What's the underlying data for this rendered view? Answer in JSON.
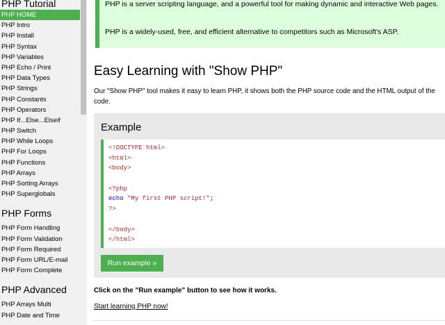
{
  "sidebar": {
    "heading_tutorial": "PHP Tutorial",
    "tutorial_items": [
      "PHP HOME",
      "PHP Intro",
      "PHP Install",
      "PHP Syntax",
      "PHP Variables",
      "PHP Echo / Print",
      "PHP Data Types",
      "PHP Strings",
      "PHP Constants",
      "PHP Operators",
      "PHP If...Else...Elseif",
      "PHP Switch",
      "PHP While Loops",
      "PHP For Loops",
      "PHP Functions",
      "PHP Arrays",
      "PHP Sorting Arrays",
      "PHP Superglobals"
    ],
    "heading_forms": "PHP Forms",
    "forms_items": [
      "PHP Form Handling",
      "PHP Form Validation",
      "PHP Form Required",
      "PHP Form URL/E-mail",
      "PHP Form Complete"
    ],
    "heading_advanced": "PHP Advanced",
    "advanced_items": [
      "PHP Arrays Multi",
      "PHP Date and Time"
    ],
    "active_color": "#4CAF50"
  },
  "main": {
    "note_line1": "PHP is a server scripting language, and a powerful tool for making dynamic and interactive Web pages.",
    "note_line2": "PHP is a widely-used, free, and efficient alternative to competitors such as Microsoft's ASP.",
    "section_title": "Easy Learning with \"Show PHP\"",
    "intro_text": "Our \"Show PHP\" tool makes it easy to learn PHP, it shows both the PHP source code and the HTML output of the code.",
    "example_title": "Example",
    "code": {
      "doctype": "<!DOCTYPE html>",
      "html_open": "<html>",
      "body_open": "<body>",
      "php_open": "<?php",
      "echo_kw": "echo",
      "echo_str": "\"My first PHP script!\"",
      "echo_end": ";",
      "php_close": "?>",
      "body_close": "</body>",
      "html_close": "</html>"
    },
    "run_button": "Run example »",
    "click_note": "Click on the \"Run example\" button to see how it works.",
    "start_link": "Start learning PHP now!",
    "accent_color": "#4CAF50",
    "note_bg": "#ddffdd"
  }
}
